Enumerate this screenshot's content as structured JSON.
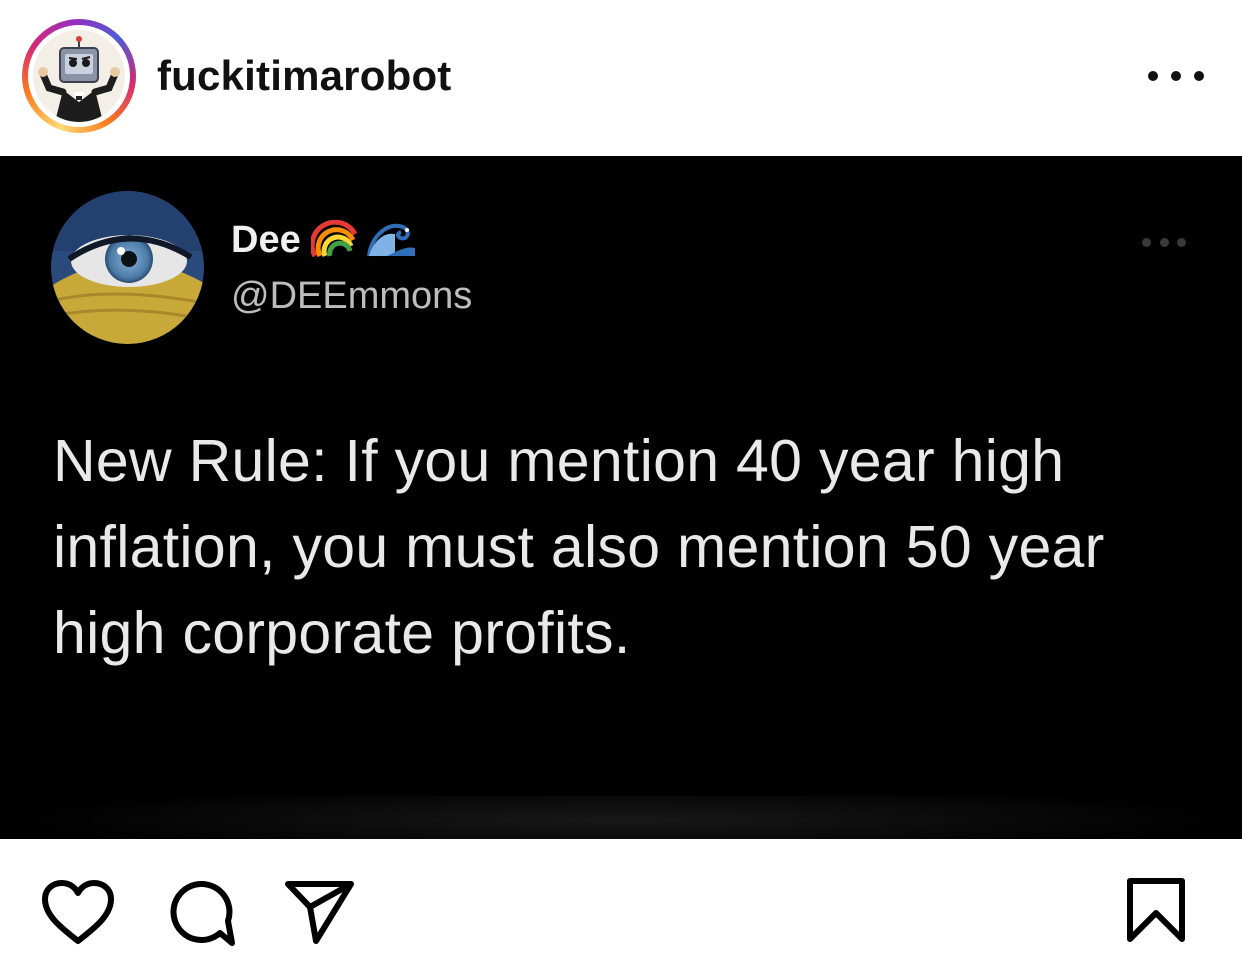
{
  "header": {
    "username": "fuckitimarobot",
    "more_icon": "more-horizontal-icon"
  },
  "tweet": {
    "name": "Dee",
    "name_emojis": [
      "rainbow-icon",
      "wave-icon"
    ],
    "handle": "@DEEmmons",
    "text": "New Rule: If you mention 40 year high inflation, you must also mention 50 year high corporate profits.",
    "more_icon": "more-horizontal-icon"
  },
  "actions": {
    "icons": [
      "heart-icon",
      "comment-icon",
      "share-icon",
      "bookmark-icon"
    ]
  }
}
